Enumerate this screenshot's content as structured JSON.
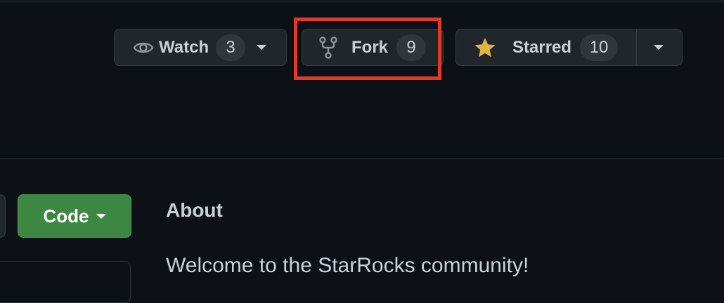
{
  "repo_actions": {
    "watch": {
      "label": "Watch",
      "count": "3",
      "icon": "eye-icon"
    },
    "fork": {
      "label": "Fork",
      "count": "9",
      "icon": "repo-forked-icon"
    },
    "star": {
      "label": "Starred",
      "count": "10",
      "icon": "star-filled-icon",
      "icon_color": "#e3b341"
    }
  },
  "code_button": {
    "label": "Code",
    "color": "#3c8741"
  },
  "about": {
    "title": "About",
    "description": "Welcome to the StarRocks community!"
  },
  "highlight_color": "#e03b24"
}
